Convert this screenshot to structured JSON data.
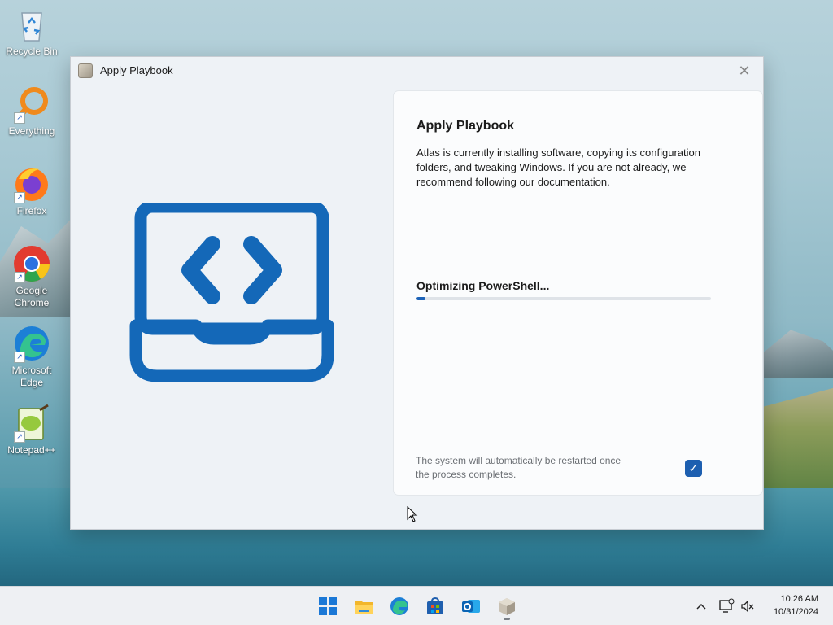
{
  "desktop": {
    "icons": [
      {
        "label": "Recycle Bin"
      },
      {
        "label": "Everything"
      },
      {
        "label": "Firefox"
      },
      {
        "label": "Google Chrome"
      },
      {
        "label": "Microsoft Edge"
      },
      {
        "label": "Notepad++"
      }
    ]
  },
  "window": {
    "title": "Apply Playbook",
    "close_icon": "close-icon",
    "heading": "Apply Playbook",
    "description": "Atlas is currently installing software, copying its configuration folders, and tweaking Windows. If you are not already, we recommend following our documentation.",
    "status": "Optimizing PowerShell...",
    "progress_fraction": 0.03,
    "restart_note": "The system will automatically be restarted once the process completes.",
    "restart_checked": true,
    "accent_color": "#1d63b8"
  },
  "taskbar": {
    "apps": [
      "start-icon",
      "file-explorer-icon",
      "edge-icon",
      "store-icon",
      "outlook-icon",
      "playbook-app-icon"
    ],
    "time": "10:26 AM",
    "date": "10/31/2024"
  }
}
